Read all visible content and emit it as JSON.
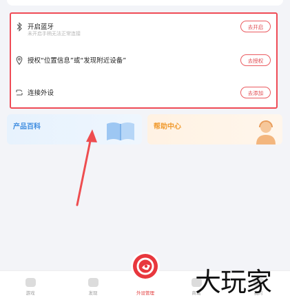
{
  "setup_card": {
    "rows": [
      {
        "icon": "bluetooth-icon",
        "title": "开启蓝牙",
        "subtitle": "未开启手柄无法正常连接",
        "button": "去开启"
      },
      {
        "icon": "location-pin-icon",
        "title": "授权“位置信息”或“发现附近设备”",
        "subtitle": "",
        "button": "去授权"
      },
      {
        "icon": "device-connect-icon",
        "title": "连接外设",
        "subtitle": "",
        "button": "去添加"
      }
    ]
  },
  "tiles": {
    "wiki": {
      "title": "产品百科",
      "icon": "open-book-icon",
      "color": "#3f8de0"
    },
    "help": {
      "title": "帮助中心",
      "icon": "support-agent-icon",
      "color": "#f09a2e"
    }
  },
  "tabbar": {
    "tabs": [
      {
        "label": "游戏",
        "icon": "gamepad-icon"
      },
      {
        "label": "发现",
        "icon": "compass-icon"
      },
      {
        "label": "外设管理",
        "icon": "controller-badge-icon",
        "active": true
      },
      {
        "label": "商城",
        "icon": "bag-icon"
      },
      {
        "label": "我的",
        "icon": "profile-icon"
      }
    ]
  },
  "watermark": {
    "text": "大玩家"
  },
  "colors": {
    "accent": "#e8373d",
    "highlight_border": "#ef4a55",
    "button_text": "#e0484e"
  }
}
